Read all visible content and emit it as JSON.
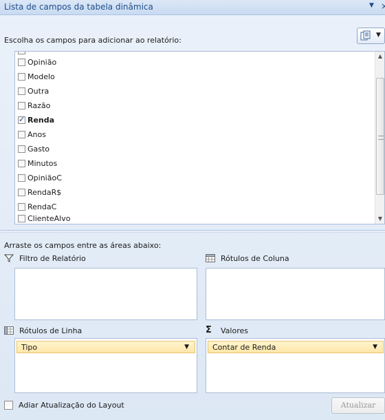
{
  "title": "Lista de campos da tabela dinâmica",
  "title_menu_icon": "dropdown-arrow",
  "title_close_icon": "close",
  "choose_label": "Escolha os campos para adicionar ao relatório:",
  "fields": [
    {
      "label": "Opinião",
      "checked": false
    },
    {
      "label": "Modelo",
      "checked": false
    },
    {
      "label": "Outra",
      "checked": false
    },
    {
      "label": "Razão",
      "checked": false
    },
    {
      "label": "Renda",
      "checked": true
    },
    {
      "label": "Anos",
      "checked": false
    },
    {
      "label": "Gasto",
      "checked": false
    },
    {
      "label": "Minutos",
      "checked": false
    },
    {
      "label": "OpiniãoC",
      "checked": false
    },
    {
      "label": "RendaR$",
      "checked": false
    },
    {
      "label": "RendaC",
      "checked": false
    },
    {
      "label": "ClienteAlvo",
      "checked": false
    }
  ],
  "drag_label": "Arraste os campos entre as áreas abaixo:",
  "areas": {
    "report_filter": {
      "label": "Filtro de Relatório",
      "icon": "filter-icon",
      "items": []
    },
    "column_labels": {
      "label": "Rótulos de Coluna",
      "icon": "column-grid-icon",
      "items": []
    },
    "row_labels": {
      "label": "Rótulos de Linha",
      "icon": "row-grid-icon",
      "items": [
        "Tipo"
      ]
    },
    "values": {
      "label": "Valores",
      "icon": "sigma-icon",
      "items": [
        "Contar de Renda"
      ]
    }
  },
  "defer_label": "Adiar Atualização do Layout",
  "defer_checked": false,
  "update_button": "Atualizar",
  "colors": {
    "accent": "#1f4d8c",
    "selected_field": "#fde7a7"
  }
}
